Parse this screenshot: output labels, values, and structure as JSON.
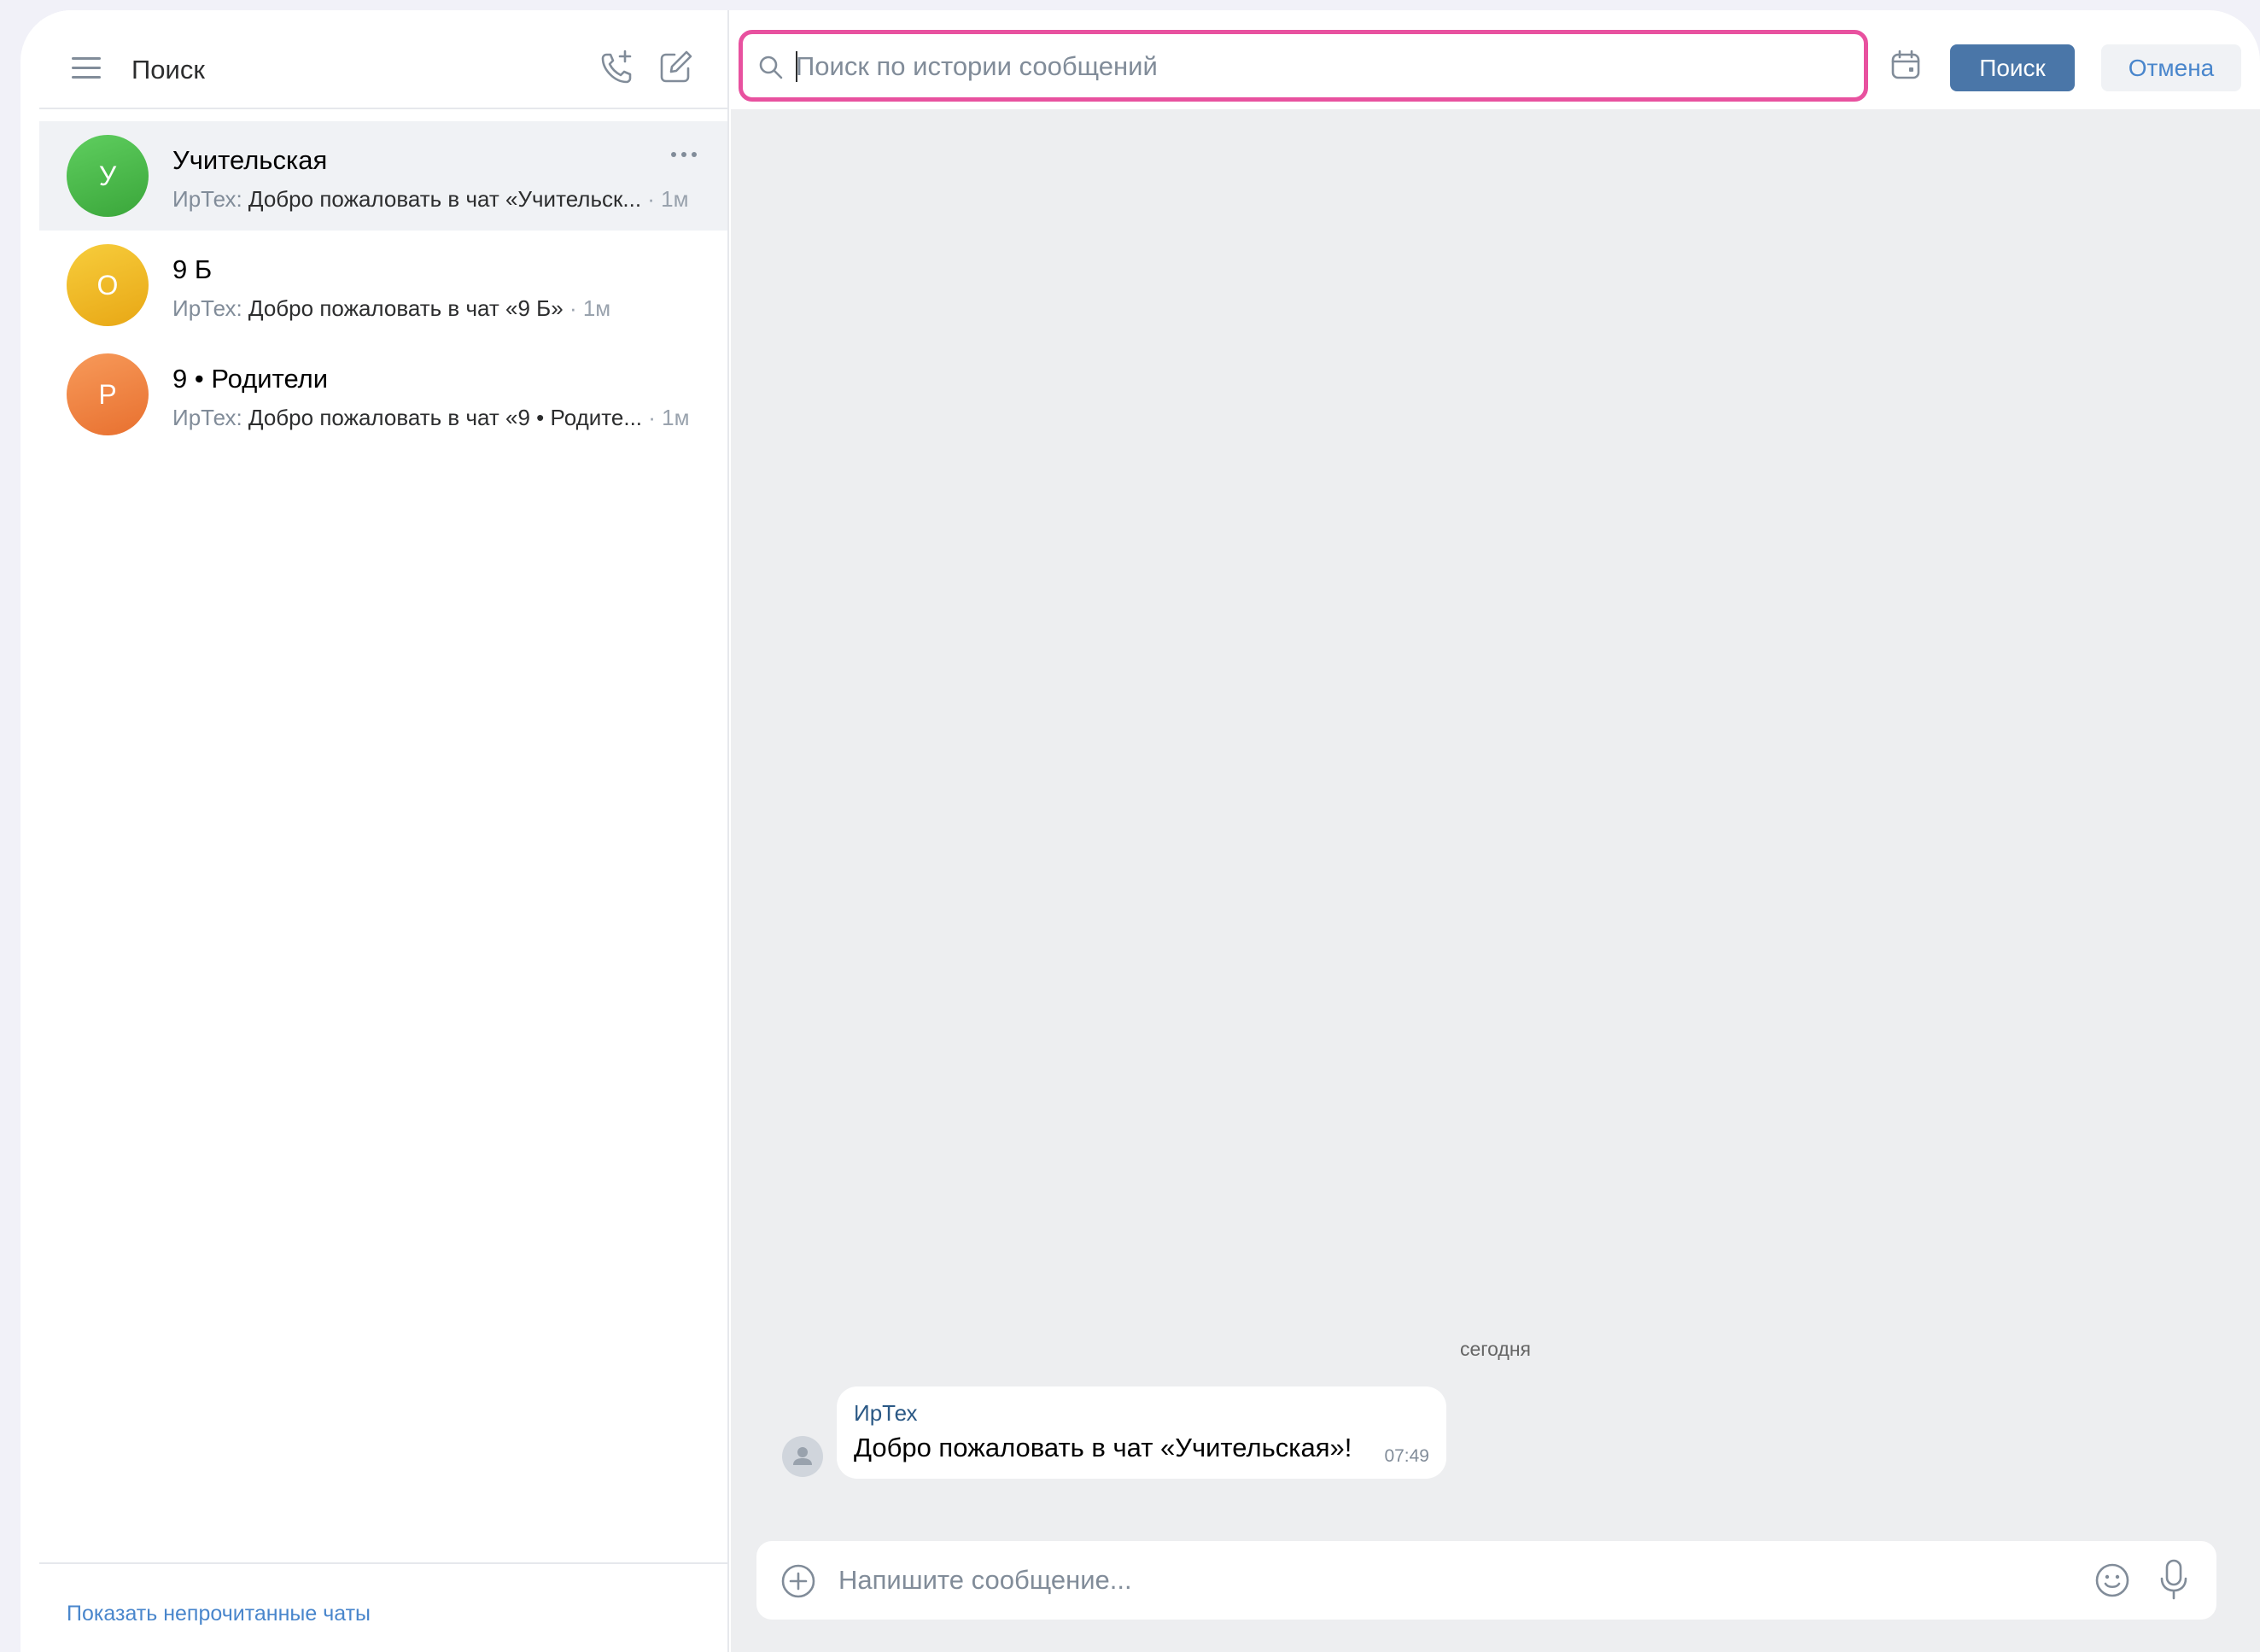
{
  "sidebar": {
    "header": {
      "title": "Поиск",
      "icons": [
        "menu-icon",
        "add-call-icon",
        "compose-icon"
      ]
    },
    "chats": [
      {
        "initial": "У",
        "title": "Учительская",
        "author": "ИрТех:",
        "preview": "Добро пожаловать в чат «Учительск...",
        "time": "· 1м",
        "color": "#4bb34b",
        "active": true
      },
      {
        "initial": "О",
        "title": "9 Б",
        "author": "ИрТех:",
        "preview": "Добро пожаловать в чат «9 Б»",
        "time": "· 1м",
        "color": "#f0b31c",
        "active": false
      },
      {
        "initial": "Р",
        "title": "9 • Родители",
        "author": "ИрТех:",
        "preview": "Добро пожаловать в чат «9 • Родите...",
        "time": "· 1м",
        "color": "#f07a3a",
        "active": false
      }
    ],
    "footer": {
      "unread_link": "Показать непрочитанные чаты"
    }
  },
  "search_bar": {
    "placeholder": "Поиск по истории сообщений",
    "value": "",
    "search_button": "Поиск",
    "cancel_button": "Отмена",
    "highlight_color": "#e8519f"
  },
  "conversation": {
    "date_separator": "сегодня",
    "messages": [
      {
        "author": "ИрТех",
        "text": "Добро пожаловать в чат «Учительская»!",
        "time": "07:49"
      }
    ]
  },
  "composer": {
    "placeholder": "Напишите сообщение..."
  },
  "colors": {
    "accent": "#4a76a8",
    "link": "#4986cc",
    "background": "#edeef0"
  }
}
